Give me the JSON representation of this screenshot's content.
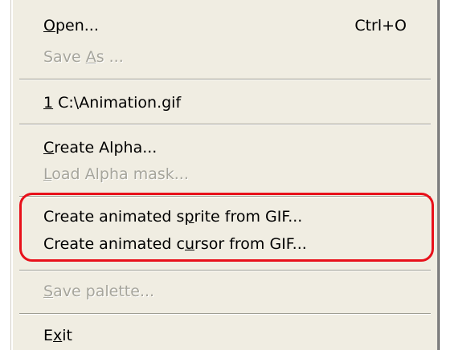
{
  "menu": {
    "open": {
      "prefix": "",
      "mnemonic": "O",
      "rest": "pen...",
      "shortcut": "Ctrl+O"
    },
    "save_as": {
      "prefix": "Save ",
      "mnemonic": "A",
      "rest": "s ..."
    },
    "recent_file": {
      "prefix": "",
      "mnemonic": "1",
      "rest": " C:\\Animation.gif"
    },
    "create_alpha": {
      "prefix": "",
      "mnemonic": "C",
      "rest": "reate Alpha..."
    },
    "load_alpha_mask": {
      "prefix": "",
      "mnemonic": "L",
      "rest": "oad Alpha mask..."
    },
    "create_sprite": {
      "prefix": "Create animated s",
      "mnemonic": "p",
      "rest": "rite from GIF..."
    },
    "create_cursor": {
      "prefix": "Create animated c",
      "mnemonic": "u",
      "rest": "rsor from GIF..."
    },
    "save_palette": {
      "prefix": "",
      "mnemonic": "S",
      "rest": "ave palette..."
    },
    "exit": {
      "prefix": "E",
      "mnemonic": "x",
      "rest": "it"
    }
  },
  "colors": {
    "menu_background": "#f0ede2",
    "disabled_text": "#a6a59c",
    "highlight_outline": "#e8101a"
  }
}
